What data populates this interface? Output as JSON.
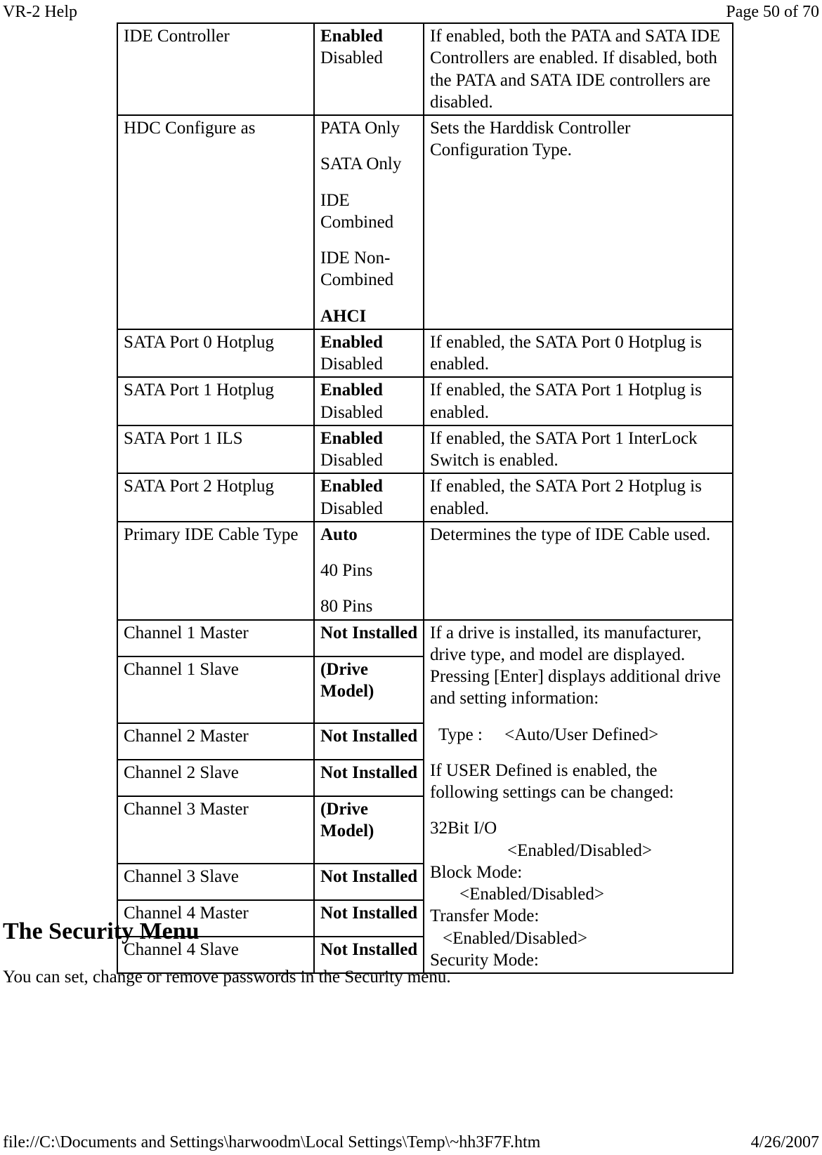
{
  "header": {
    "left": "VR-2 Help",
    "right": "Page 50 of 70"
  },
  "footer": {
    "left": "file://C:\\Documents and Settings\\harwoodm\\Local Settings\\Temp\\~hh3F7F.htm",
    "right": "4/26/2007"
  },
  "section": {
    "title": "The Security Menu",
    "desc": "You can set, change or remove passwords in the Security menu."
  },
  "rows": {
    "r1": {
      "name": "IDE Controller",
      "opt_bold": "Enabled",
      "opt_plain": "Disabled",
      "desc": "If enabled, both the PATA and SATA IDE Controllers are enabled.  If disabled, both the PATA and SATA IDE controllers are disabled."
    },
    "r2": {
      "name": "HDC Configure as",
      "o1": "PATA Only",
      "o2": "SATA Only",
      "o3": "IDE Combined",
      "o4": "IDE Non-Combined",
      "o5": "AHCI",
      "desc": "Sets the Harddisk Controller Configuration Type."
    },
    "r3": {
      "name": "SATA Port 0 Hotplug",
      "opt_bold": "Enabled",
      "opt_plain": "Disabled",
      "desc": "If enabled, the SATA Port 0 Hotplug is enabled."
    },
    "r4": {
      "name": "SATA Port 1 Hotplug",
      "opt_bold": "Enabled",
      "opt_plain": "Disabled",
      "desc": "If enabled, the SATA Port 1 Hotplug is enabled."
    },
    "r5": {
      "name": "SATA Port 1 ILS",
      "opt_bold": "Enabled",
      "opt_plain": "Disabled",
      "desc": "If enabled, the SATA Port 1 InterLock Switch is enabled."
    },
    "r6": {
      "name": "SATA Port 2 Hotplug",
      "opt_bold": "Enabled",
      "opt_plain": "Disabled",
      "desc": "If enabled, the SATA Port 2 Hotplug is enabled."
    },
    "r7": {
      "name": "Primary IDE Cable Type",
      "o1": "Auto",
      "o2": "40 Pins",
      "o3": "80 Pins",
      "desc": "Determines the type of IDE Cable used."
    },
    "ch1m": {
      "name": "Channel 1 Master",
      "val": "Not Installed"
    },
    "ch1s": {
      "name": "Channel 1 Slave",
      "val": "(Drive Model)"
    },
    "ch2m": {
      "name": "Channel 2 Master",
      "val": "Not Installed"
    },
    "ch2s": {
      "name": "Channel 2 Slave",
      "val": "Not Installed"
    },
    "ch3m": {
      "name": "Channel 3 Master",
      "val": "(Drive Model)"
    },
    "ch3s": {
      "name": "Channel 3 Slave",
      "val": "Not Installed"
    },
    "ch4m": {
      "name": "Channel 4 Master",
      "val": "Not Installed"
    },
    "ch4s": {
      "name": "Channel 4 Slave",
      "val": "Not Installed"
    },
    "chdesc": {
      "p1": "If a drive is installed, its manufacturer, drive type, and model are displayed.  Pressing [Enter] displays additional drive and setting information:",
      "type_line": "  Type :     <Auto/User Defined>",
      "p2": "If USER Defined is enabled, the following settings can be changed:",
      "s1": "32Bit I/O",
      "s1v": "<Enabled/Disabled>",
      "s2": "Block Mode:",
      "s2v": "<Enabled/Disabled>",
      "s3": "Transfer Mode:",
      "s3v": "<Enabled/Disabled>",
      "s4": "Security Mode:"
    }
  }
}
